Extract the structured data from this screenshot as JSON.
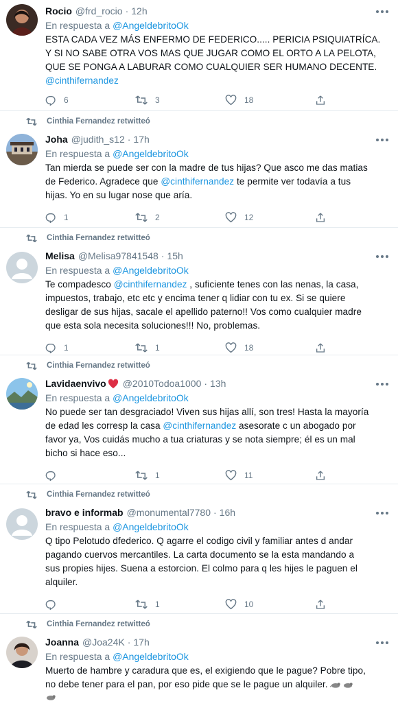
{
  "retweeted_by_label": "Cinthia Fernandez retwitteó",
  "reply_prefix": "En respuesta a",
  "reply_target": "@AngeldebritoOk",
  "tweets": [
    {
      "name": "Rocio",
      "handle": "@frd_rocio",
      "sep": "·",
      "time": "12h",
      "retweeted": false,
      "lines": [
        "ESTA CADA VEZ MÁS ENFERMO DE FEDERICO.....  PERICIA PSIQUIATRÍCA.",
        "Y SI NO SABE OTRA VOS MAS QUE JUGAR COMO EL ORTO A LA PELOTA,",
        "QUE SE PONGA A LABURAR COMO CUALQUIER SER HUMANO DECENTE."
      ],
      "mention_line": "@cinthifernandez",
      "replies": "6",
      "retweets": "3",
      "likes": "18"
    },
    {
      "name": "Joha",
      "handle": "@judith_s12",
      "sep": "·",
      "time": "17h",
      "retweeted": true,
      "line1": "Tan mierda se puede ser con la madre de tus hijas? Que asco me das matias",
      "line2_pre": "de Federico. Agradece que ",
      "line2_mention": "@cinthifernandez",
      "line2_post": " te permite ver todavía a tus",
      "line3": "hijas. Yo en su lugar nose que aría.",
      "replies": "1",
      "retweets": "2",
      "likes": "12"
    },
    {
      "name": "Melisa",
      "handle": "@Melisa97841548",
      "sep": "·",
      "time": "15h",
      "retweeted": true,
      "line1_pre": "Te compadesco ",
      "line1_mention": "@cinthifernandez",
      "line1_post": " , suficiente tenes con las nenas, la casa,",
      "line2": "impuestos, trabajo, etc etc y encima tener q lidiar con tu ex. Si se quiere",
      "line3": "desligar de sus hijas, sacale el apellido paterno!! Vos como cualquier madre",
      "line4": "que esta sola necesita soluciones!!! No, problemas.",
      "replies": "1",
      "retweets": "1",
      "likes": "18"
    },
    {
      "name": "Lavidaenvivo",
      "handle": "@2010Todoa1000",
      "sep": "·",
      "time": "13h",
      "retweeted": true,
      "line1": "No puede ser tan desgraciado! Viven sus hijas allí, son tres! Hasta la mayoría",
      "line2_pre": "de edad les corresp la casa ",
      "line2_mention": "@cinthifernandez",
      "line2_post": "  asesorate c un abogado por",
      "line3": "favor ya, Vos cuidás mucho a tua criaturas y se nota siempre; él es un mal",
      "line4": "bicho si hace eso...",
      "replies": "",
      "retweets": "1",
      "likes": "11"
    },
    {
      "name": "bravo e informab",
      "handle": "@monumental7780",
      "sep": "·",
      "time": "16h",
      "retweeted": true,
      "lines": [
        "Q tipo Pelotudo dfederico.  Q agarre el codigo civil  y familiar antes d andar",
        "pagando cuervos  mercantiles.  La carta documento se la esta mandando a",
        "sus propies hijes. Suena a estorcion. El colmo     para q les hijes le paguen el",
        "alquiler."
      ],
      "replies": "",
      "retweets": "1",
      "likes": "10"
    },
    {
      "name": "Joanna",
      "handle": "@Joa24K",
      "sep": "·",
      "time": "17h",
      "retweeted": true,
      "lines": [
        "Muerto de hambre y caradura que es, el exigiendo que le pague? Pobre tipo,",
        "no debe tener para el pan, por eso pide que se le pague un alquiler."
      ]
    }
  ]
}
